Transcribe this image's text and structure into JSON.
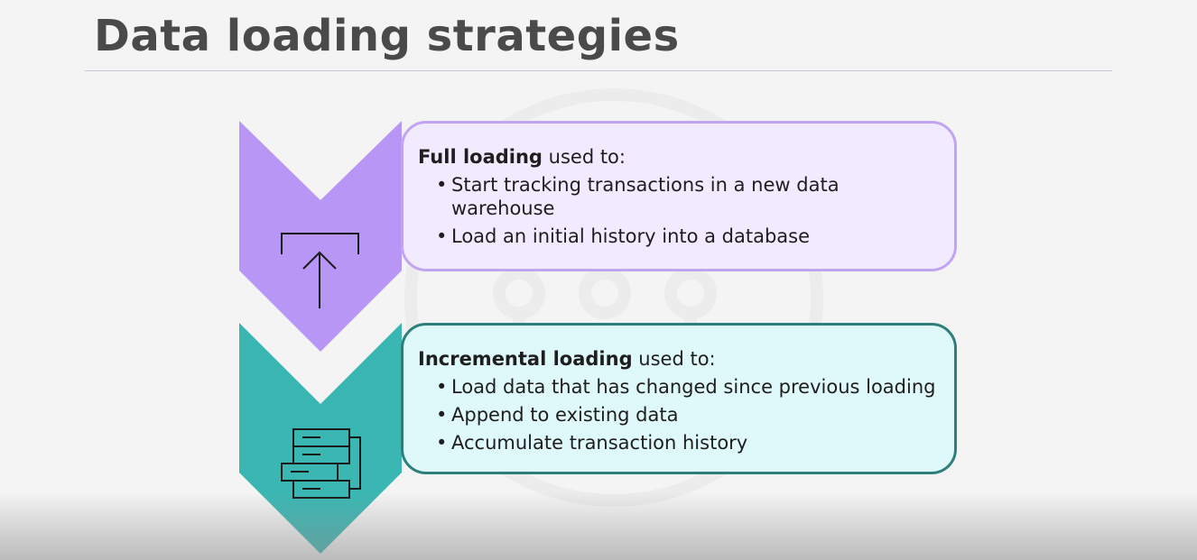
{
  "slide": {
    "title": "Data loading strategies"
  },
  "full_loading": {
    "heading_bold": "Full loading",
    "heading_rest": " used to:",
    "items": [
      "Start tracking transactions in a new data warehouse",
      "Load an initial history into a database"
    ],
    "icon": "upload-icon",
    "chevron_color": "#b896f5",
    "card_color": "#f2ebff",
    "border_color": "#c2a4f4"
  },
  "incremental_loading": {
    "heading_bold": "Incremental loading",
    "heading_rest": " used to:",
    "items": [
      "Load data that has changed since previous loading",
      "Append to existing data",
      "Accumulate transaction history"
    ],
    "icon": "server-stack-icon",
    "chevron_color": "#3ab7b3",
    "card_color": "#dff9fb",
    "border_color": "#2e7f7b"
  }
}
